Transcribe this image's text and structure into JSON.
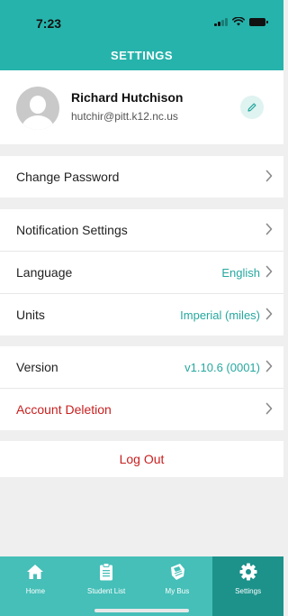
{
  "status_bar": {
    "time": "7:23"
  },
  "header": {
    "title": "SETTINGS"
  },
  "profile": {
    "name": "Richard Hutchison",
    "email": "hutchir@pitt.k12.nc.us"
  },
  "rows": {
    "change_password": {
      "label": "Change Password"
    },
    "notification_settings": {
      "label": "Notification Settings"
    },
    "language": {
      "label": "Language",
      "value": "English"
    },
    "units": {
      "label": "Units",
      "value": "Imperial (miles)"
    },
    "version": {
      "label": "Version",
      "value": "v1.10.6 (0001)"
    },
    "account_deletion": {
      "label": "Account Deletion"
    }
  },
  "logout": {
    "label": "Log Out"
  },
  "tabs": [
    {
      "label": "Home",
      "icon": "home-icon",
      "active": false
    },
    {
      "label": "Student List",
      "icon": "clipboard-icon",
      "active": false
    },
    {
      "label": "My Bus",
      "icon": "bus-icon",
      "active": false
    },
    {
      "label": "Settings",
      "icon": "gear-icon",
      "active": true
    }
  ],
  "colors": {
    "brand": "#26b3ab",
    "tabbar": "#45bfb8",
    "tab_active": "#1c928b",
    "accent_text": "#26a79f",
    "danger": "#c82020"
  }
}
